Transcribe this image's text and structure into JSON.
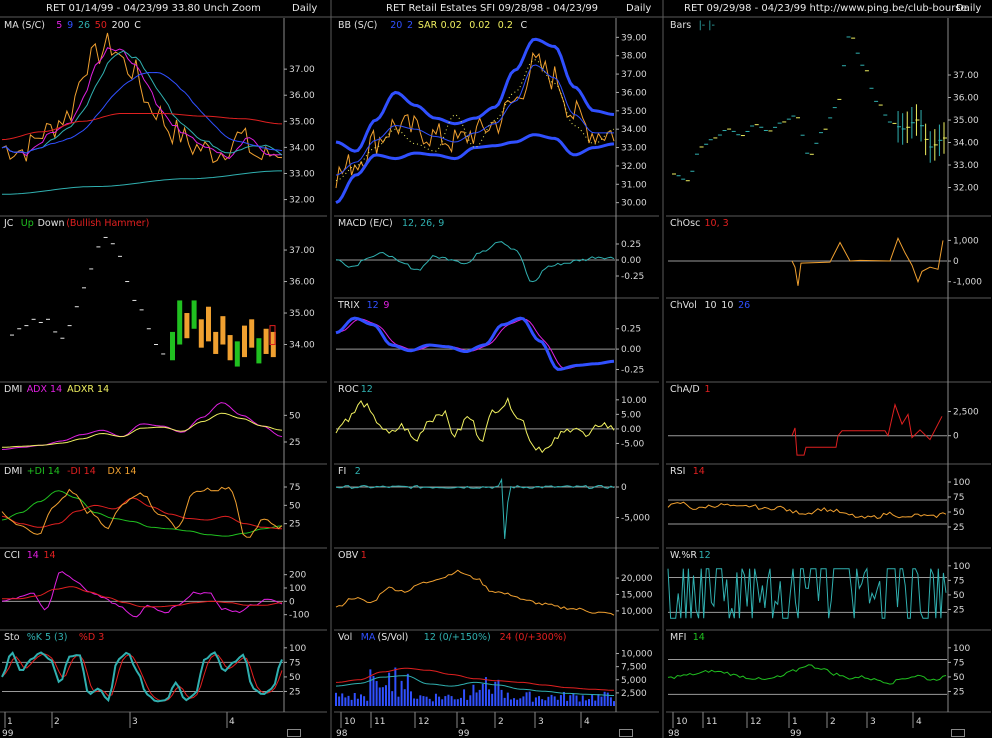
{
  "headers": [
    {
      "text": "RET  01/14/99 - 04/23/99    33.80   Unch    Zoom",
      "daily": "Daily"
    },
    {
      "text": "RET   Retail Estates SFI  09/28/98 - 04/23/99",
      "daily": "Daily"
    },
    {
      "text": "RET  09/29/98 - 04/23/99    http://www.ping.be/club-bourse",
      "daily": "Daily"
    }
  ],
  "colors": {
    "grid": "#3a3a3a",
    "axis": "#9a9a9a",
    "orange": "#f0a030",
    "red": "#e02020",
    "blue": "#3050ff",
    "cyan": "#30b0b0",
    "yellow": "#f0f060",
    "magenta": "#e020e0",
    "green": "#20c020",
    "white": "#e6e6e6"
  },
  "chart_data": [
    {
      "type": "line",
      "panel": "col1-ma",
      "title_parts": [
        "MA (S/C)",
        "5",
        "9",
        "26",
        "50",
        "200",
        "C"
      ],
      "series": [
        {
          "name": "C"
        },
        {
          "name": "MA 5"
        },
        {
          "name": "MA 9"
        },
        {
          "name": "MA 26"
        },
        {
          "name": "MA 50"
        },
        {
          "name": "MA 200"
        }
      ],
      "yticks": [
        "37.00",
        "36.00",
        "35.00",
        "34.00",
        "33.00",
        "32.00"
      ],
      "ylim": [
        31.6,
        38.5
      ]
    },
    {
      "type": "bar",
      "panel": "col1-jc",
      "title_parts": [
        "JC",
        "Up",
        "Down",
        "(Bullish Hammer)"
      ],
      "yticks": [
        "37.00",
        "36.00",
        "35.00",
        "34.00"
      ],
      "ylim": [
        33.0,
        37.7
      ]
    },
    {
      "type": "line",
      "panel": "col1-dmi-adx",
      "title_parts": [
        "DMI",
        "ADX 14",
        "ADXR 14"
      ],
      "yticks": [
        "50",
        "25"
      ],
      "ylim": [
        10,
        70
      ]
    },
    {
      "type": "line",
      "panel": "col1-dmi-di",
      "title_parts": [
        "DMI",
        "+DI 14",
        "-DI 14",
        "DX 14"
      ],
      "yticks": [
        "75",
        "50",
        "25"
      ],
      "ylim": [
        0,
        90
      ]
    },
    {
      "type": "line",
      "panel": "col1-cci",
      "title_parts": [
        "CCI",
        "14",
        "14"
      ],
      "yticks": [
        "200",
        "100",
        "0",
        "-100"
      ],
      "ylim": [
        -170,
        310
      ]
    },
    {
      "type": "line",
      "panel": "col1-sto",
      "title_parts": [
        "Sto",
        "%K 5 (3)",
        "%D 3"
      ],
      "yticks": [
        "100",
        "75",
        "50",
        "25"
      ],
      "ylim": [
        0,
        110
      ],
      "xticks": [
        "1",
        "2",
        "3",
        "4"
      ],
      "xyear": "99"
    },
    {
      "type": "line",
      "panel": "col2-bb",
      "title_parts": [
        "BB (S/C)",
        "20",
        "2",
        "SAR",
        "0.02",
        "0.02",
        "0.2",
        "C"
      ],
      "yticks": [
        "39.00",
        "38.00",
        "37.00",
        "36.00",
        "35.00",
        "34.00",
        "33.00",
        "32.00",
        "31.00",
        "30.00"
      ],
      "ylim": [
        29.6,
        39.4
      ]
    },
    {
      "type": "line",
      "panel": "col2-macd",
      "title_parts": [
        "MACD (E/C)",
        "12, 26, 9"
      ],
      "yticks": [
        "0.25",
        "0.00",
        "-0.25"
      ],
      "ylim": [
        -0.5,
        0.5
      ]
    },
    {
      "type": "line",
      "panel": "col2-trix",
      "title_parts": [
        "TRIX",
        "12",
        "9"
      ],
      "yticks": [
        "0.25",
        "0.00",
        "-0.25"
      ],
      "ylim": [
        -0.33,
        0.48
      ]
    },
    {
      "type": "line",
      "panel": "col2-roc",
      "title_parts": [
        "ROC",
        "12"
      ],
      "yticks": [
        "10.00",
        "5.00",
        "0.00",
        "-5.00"
      ],
      "ylim": [
        -10,
        12
      ]
    },
    {
      "type": "line",
      "panel": "col2-fi",
      "title_parts": [
        "FI",
        "2"
      ],
      "yticks": [
        "0",
        "-5,000"
      ],
      "ylim": [
        -9000,
        1800
      ]
    },
    {
      "type": "line",
      "panel": "col2-obv",
      "title_parts": [
        "OBV",
        "1"
      ],
      "yticks": [
        "20,000",
        "15,000",
        "10,000"
      ],
      "ylim": [
        6000,
        25500
      ]
    },
    {
      "type": "bar",
      "panel": "col2-vol",
      "title_parts": [
        "Vol",
        "MA",
        "(S/Vol)",
        "12 (0/+150%)",
        "24 (0/+300%)"
      ],
      "yticks": [
        "10,000",
        "7,500",
        "5,000",
        "2,500"
      ],
      "ylim": [
        0,
        12200
      ],
      "xticks": [
        "10",
        "11",
        "12",
        "1",
        "2",
        "3",
        "4"
      ],
      "xyear_start": "98",
      "xyear_mid": "99"
    },
    {
      "type": "bar",
      "panel": "col3-bars",
      "title_parts": [
        "Bars",
        "|-  |-"
      ],
      "yticks": [
        "37.00",
        "36.00",
        "35.00",
        "34.00",
        "33.00",
        "32.00"
      ],
      "ylim": [
        31.0,
        39.0
      ]
    },
    {
      "type": "line",
      "panel": "col3-chosc",
      "title_parts": [
        "ChOsc",
        "10, 3"
      ],
      "yticks": [
        "1,000",
        "0",
        "-1,000"
      ],
      "ylim": [
        -1500,
        1600
      ]
    },
    {
      "type": "line",
      "panel": "col3-chvol",
      "title_parts": [
        "ChVol",
        "10",
        "10",
        "26"
      ]
    },
    {
      "type": "line",
      "panel": "col3-chad",
      "title_parts": [
        "ChA/D",
        "1"
      ],
      "yticks": [
        "2,500",
        "0"
      ],
      "ylim": [
        -2300,
        4300
      ]
    },
    {
      "type": "line",
      "panel": "col3-rsi",
      "title_parts": [
        "RSI",
        "14"
      ],
      "yticks": [
        "100",
        "75",
        "50",
        "25"
      ],
      "ylim": [
        0,
        110
      ]
    },
    {
      "type": "line",
      "panel": "col3-wr",
      "title_parts": [
        "W.%R",
        "12"
      ],
      "yticks": [
        "100",
        "75",
        "50",
        "25"
      ],
      "ylim": [
        0,
        110
      ]
    },
    {
      "type": "line",
      "panel": "col3-mfi",
      "title_parts": [
        "MFI",
        "14"
      ],
      "yticks": [
        "100",
        "75",
        "50",
        "25"
      ],
      "ylim": [
        0,
        110
      ],
      "xticks": [
        "10",
        "11",
        "12",
        "1",
        "2",
        "3",
        "4"
      ],
      "xyear_start": "98",
      "xyear_mid": "99"
    }
  ]
}
